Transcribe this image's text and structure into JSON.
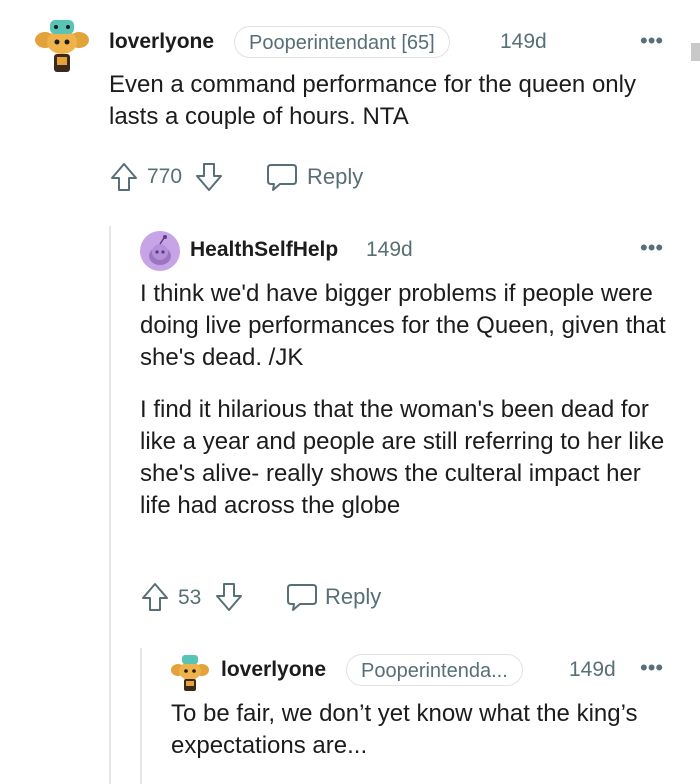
{
  "comments": [
    {
      "username": "loverlyone",
      "flair": "Pooperintendant [65]",
      "time": "149d",
      "body": [
        "Even a command performance for the queen only lasts a couple of hours. NTA"
      ],
      "votes": "770",
      "reply_label": "Reply"
    },
    {
      "username": "HealthSelfHelp",
      "time": "149d",
      "body": [
        "I think we'd have bigger problems if people were doing live performances for the Queen, given that she's dead. /JK",
        "I find it hilarious that the woman's been dead for like a year and people are still referring to her like she's alive- really shows the culteral impact her life had across the globe"
      ],
      "votes": "53",
      "reply_label": "Reply"
    },
    {
      "username": "loverlyone",
      "flair": "Pooperintenda...",
      "time": "149d",
      "body": [
        "To be fair, we don’t yet know what the king’s expectations are..."
      ]
    }
  ],
  "more_label": "•••",
  "colors": {
    "text": "#1c1c1c",
    "meta": "#576f76",
    "thread_line": "#e5e5e5",
    "avatar_purple": "#c6a4e6"
  }
}
